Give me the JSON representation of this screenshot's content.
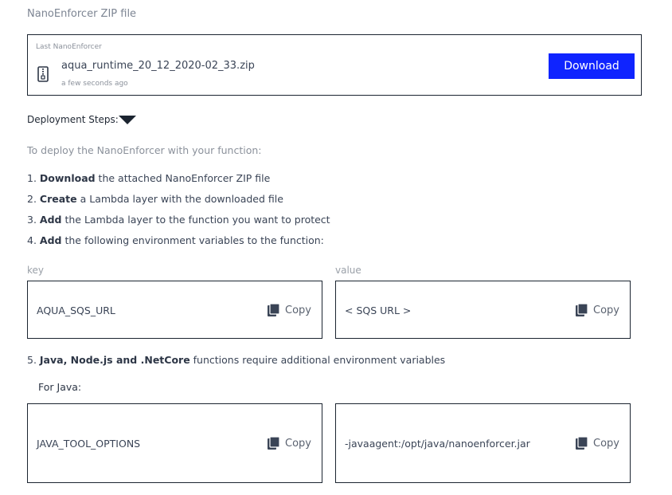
{
  "section_title": "NanoEnforcer ZIP file",
  "zip": {
    "caption": "Last NanoEnforcer",
    "filename": "aqua_runtime_20_12_2020-02_33.zip",
    "timestamp": "a few seconds ago",
    "download_label": "Download",
    "icon": "zip-file-icon"
  },
  "steps_toggle_label": "Deployment Steps:",
  "intro": "To deploy the NanoEnforcer with your function:",
  "steps": [
    {
      "prefix": "1. ",
      "bold": "Download",
      "rest": " the attached NanoEnforcer ZIP file"
    },
    {
      "prefix": "2. ",
      "bold": "Create",
      "rest": " a Lambda layer with the downloaded file"
    },
    {
      "prefix": "3. ",
      "bold": "Add",
      "rest": " the Lambda layer to the function you want to protect"
    },
    {
      "prefix": "4. ",
      "bold": "Add",
      "rest": " the following environment variables to the function:"
    }
  ],
  "step5": {
    "prefix": "5. ",
    "bold": "Java, Node.js and .NetCore",
    "rest": " functions require additional environment variables"
  },
  "key_label": "key",
  "value_label": "value",
  "copy_label": "Copy",
  "env_vars": [
    {
      "key": "AQUA_SQS_URL",
      "value": "< SQS URL >"
    }
  ],
  "for_java_label": "For Java:",
  "java_vars": [
    {
      "key": "JAVA_TOOL_OPTIONS",
      "value": "-javaagent:/opt/java/nanoenforcer.jar"
    }
  ],
  "colors": {
    "accent": "#0f24ff",
    "border": "#1b2430",
    "muted_text": "#8b919b",
    "body_text": "#3a4456"
  }
}
